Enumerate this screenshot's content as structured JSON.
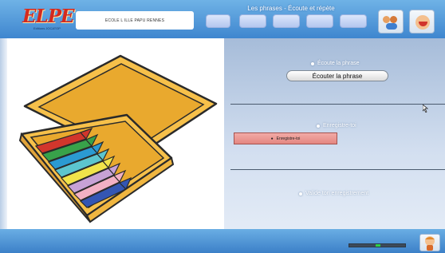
{
  "header": {
    "logo_text": "ELPE",
    "logo_sub": "Editions JOCATOP",
    "school_name": "ECOLE L ILLE PAPU RENNES",
    "title": "Les phrases - Écoute et répète",
    "steps": [
      "step-1",
      "step-2",
      "step-3",
      "step-4",
      "step-5"
    ],
    "buttons": {
      "kids_icon": "children-icon",
      "speak_icon": "speaking-face-icon"
    }
  },
  "picture": {
    "icon": "crayon-box-illustration"
  },
  "actions": {
    "listen_caption": "Écoute la phrase",
    "listen_button": "Écouter la phrase",
    "record_caption": "Enregistre-toi",
    "record_button": "Enregistre-toi",
    "validate_caption": "Valide ton enregistrement"
  },
  "footer": {
    "progress": 0.5,
    "help_icon": "helper-character-icon"
  },
  "colors": {
    "header_blue": "#3e86cf",
    "record_red": "#e48781",
    "progress_green": "#2fd04a"
  }
}
